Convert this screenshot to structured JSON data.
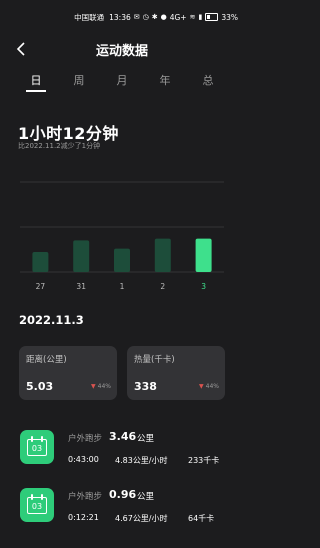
{
  "status": {
    "carrier": "中国联通",
    "time": "13:36",
    "network": "4G+",
    "battery": "33%"
  },
  "header": {
    "title": "运动数据"
  },
  "tabs": [
    {
      "label": "日",
      "active": true
    },
    {
      "label": "周",
      "active": false
    },
    {
      "label": "月",
      "active": false
    },
    {
      "label": "年",
      "active": false
    },
    {
      "label": "总",
      "active": false
    }
  ],
  "summary": {
    "duration": "1小时12分钟",
    "compare": "比2022.11.2减少了1分钟"
  },
  "chart_data": {
    "type": "bar",
    "categories": [
      "27",
      "31",
      "1",
      "2",
      "3"
    ],
    "values": [
      1.2,
      1.9,
      1.4,
      2.0,
      2.0
    ],
    "highlight_index": 4,
    "ylim": [
      0,
      5.4
    ],
    "grid": true,
    "colors": {
      "bar": "#1d4d3a",
      "highlight": "#3ee08c",
      "grid": "#4a4a4c"
    }
  },
  "date_heading": "2022.11.3",
  "stats": [
    {
      "label": "距离(公里)",
      "value": "5.03",
      "change": "44%"
    },
    {
      "label": "热量(千卡)",
      "value": "338",
      "change": "44%"
    }
  ],
  "activities": [
    {
      "icon_day": "03",
      "type": "户外跑步",
      "distance": "3.46",
      "unit": "公里",
      "duration": "0:43:00",
      "pace": "4.83公里/小时",
      "calories": "233千卡"
    },
    {
      "icon_day": "03",
      "type": "户外跑步",
      "distance": "0.96",
      "unit": "公里",
      "duration": "0:12:21",
      "pace": "4.67公里/小时",
      "calories": "64千卡"
    }
  ]
}
